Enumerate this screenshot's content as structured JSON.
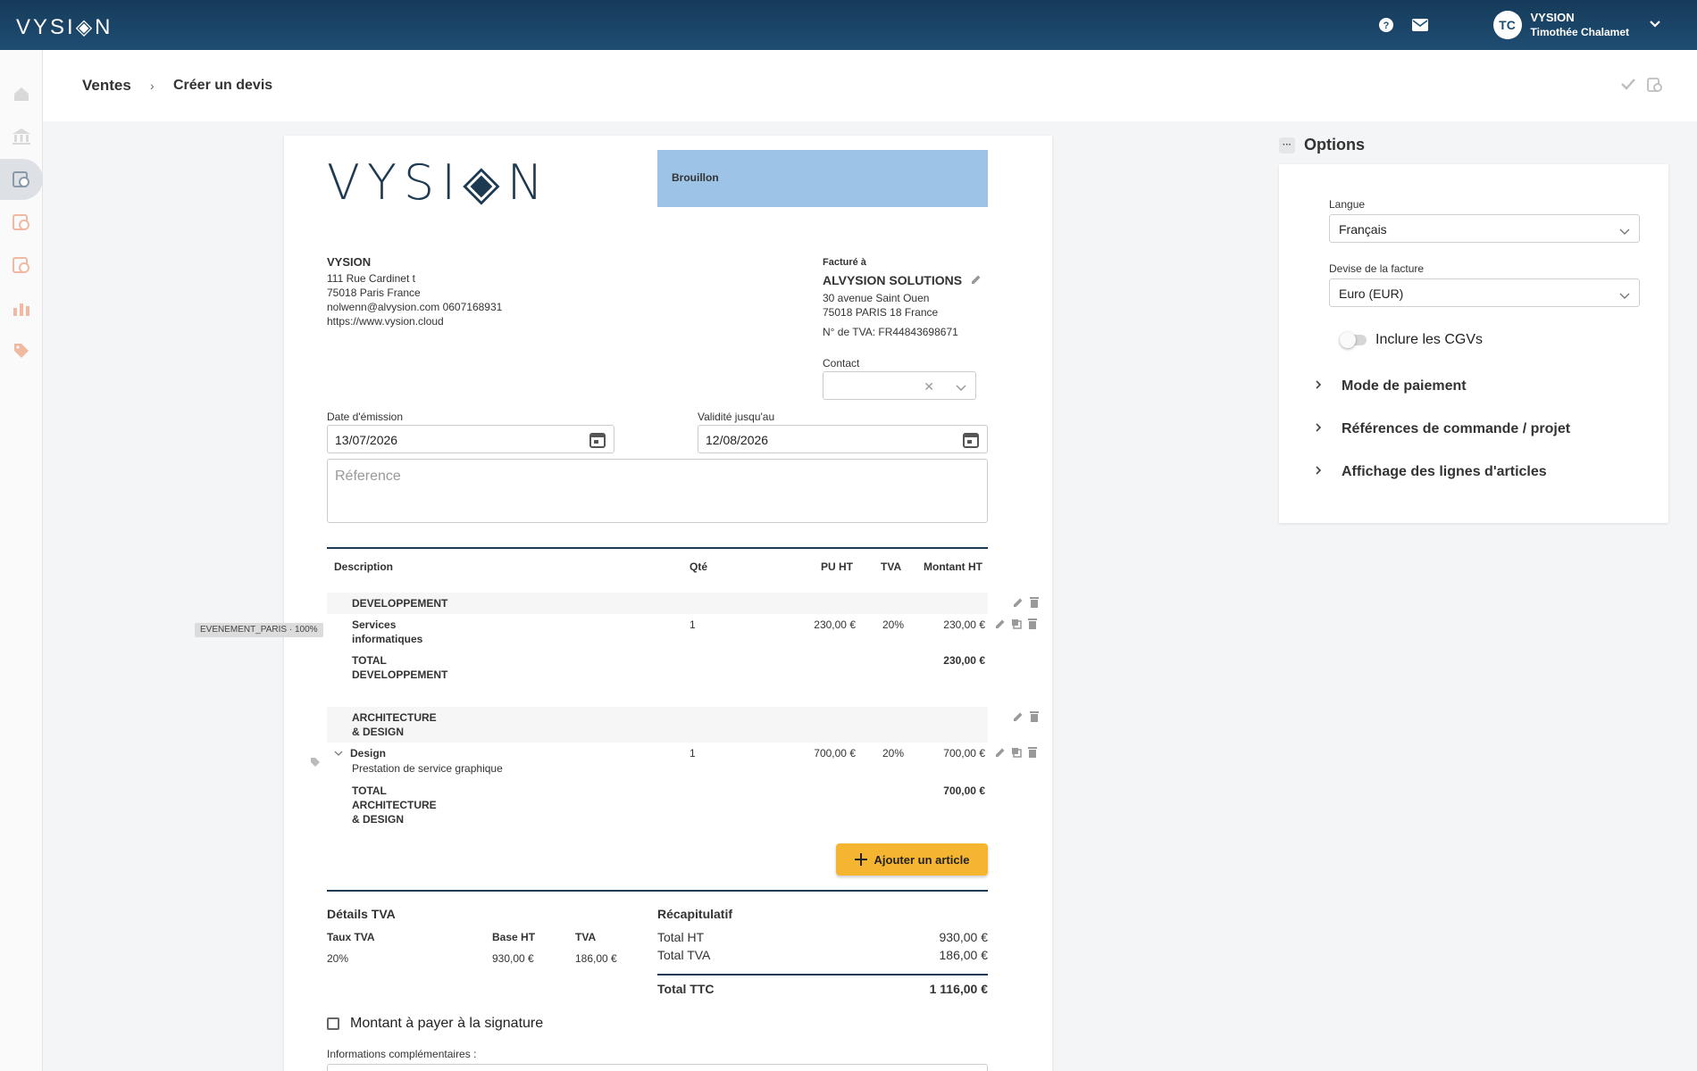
{
  "app": {
    "logo": "VYSI◈N",
    "company": "VYSION",
    "user_name": "Timothée Chalamet",
    "initials": "TC"
  },
  "breadcrumb": {
    "root": "Ventes",
    "sep": "›",
    "current": "Créer un devis"
  },
  "doc": {
    "logo": "VYSI◈N",
    "status": "Brouillon",
    "seller": {
      "name": "VYSION",
      "lines": [
        "111 Rue Cardinet t",
        "75018 Paris France",
        "nolwenn@alvysion.com 0607168931",
        "https://www.vysion.cloud"
      ]
    },
    "buyer": {
      "label": "Facturé à",
      "name": "ALVYSION SOLUTIONS",
      "lines": [
        "30 avenue Saint Ouen",
        "75018 PARIS 18 France"
      ],
      "tva": "N° de TVA: FR44843698671"
    },
    "contact_label": "Contact",
    "issue_label": "Date d'émission",
    "issue_date": "13/07/2026",
    "valid_label": "Validité jusqu'au",
    "valid_date": "12/08/2026",
    "ref_placeholder": "Réference",
    "table_headers": {
      "desc": "Description",
      "qty": "Qté",
      "pu": "PU HT",
      "tva": "TVA",
      "amount": "Montant HT"
    },
    "group1": {
      "name": "DEVELOPPEMENT",
      "item_name": "Services informatiques",
      "item_qty": "1",
      "item_pu": "230,00 €",
      "item_tva": "20%",
      "item_amount": "230,00 €",
      "total_label": "TOTAL DEVELOPPEMENT",
      "total": "230,00 €"
    },
    "tag": "EVENEMENT_PARIS · 100%",
    "group2": {
      "name_l1": "ARCHITECTURE",
      "name_l2": "& DESIGN",
      "item_name": "Design",
      "item_desc": "Prestation de service graphique",
      "item_qty": "1",
      "item_pu": "700,00 €",
      "item_tva": "20%",
      "item_amount": "700,00 €",
      "total_l1": "TOTAL",
      "total_l2": "ARCHITECTURE",
      "total_l3": "& DESIGN",
      "total": "700,00 €"
    },
    "add_button": "Ajouter un article",
    "tva_details": {
      "title": "Détails TVA",
      "col_rate": "Taux TVA",
      "col_base": "Base HT",
      "col_tva": "TVA",
      "rate": "20%",
      "base": "930,00 €",
      "tva": "186,00 €"
    },
    "summary": {
      "title": "Récapitulatif",
      "total_ht_label": "Total HT",
      "total_ht": "930,00 €",
      "total_tva_label": "Total TVA",
      "total_tva": "186,00 €",
      "total_ttc_label": "Total TTC",
      "total_ttc": "1 116,00 €"
    },
    "sign_label": "Montant à payer à la signature",
    "infos_label": "Informations complémentaires :"
  },
  "options": {
    "title": "Options",
    "lang_label": "Langue",
    "lang_value": "Français",
    "currency_label": "Devise de la facture",
    "currency_value": "Euro (EUR)",
    "cgv_label": "Inclure les CGVs",
    "acc1": "Mode de paiement",
    "acc2": "Références de commande / projet",
    "acc3": "Affichage des lignes d'articles"
  },
  "colors": {
    "topbar": "#1e4d72",
    "status": "#9dc3e6",
    "accent_button": "#f5b531",
    "sidebar_icons": "#f2b9a2"
  }
}
